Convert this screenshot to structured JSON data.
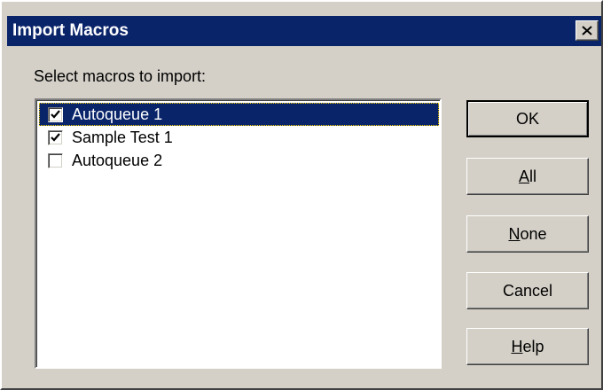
{
  "window": {
    "title": "Import Macros",
    "close_icon": "close-x-icon"
  },
  "prompt": "Select macros to import:",
  "macros": [
    {
      "label": "Autoqueue 1",
      "checked": true,
      "selected": true
    },
    {
      "label": "Sample Test 1",
      "checked": true,
      "selected": false
    },
    {
      "label": "Autoqueue 2",
      "checked": false,
      "selected": false
    }
  ],
  "buttons": {
    "ok": {
      "label": "OK"
    },
    "all": {
      "mnemonic": "A",
      "rest": "ll"
    },
    "none": {
      "mnemonic": "N",
      "rest": "one"
    },
    "cancel": {
      "label": "Cancel"
    },
    "help": {
      "mnemonic": "H",
      "rest": "elp"
    }
  },
  "colors": {
    "titlebar": "#0a246a",
    "face": "#d4d0c8",
    "selection": "#0a246a"
  }
}
